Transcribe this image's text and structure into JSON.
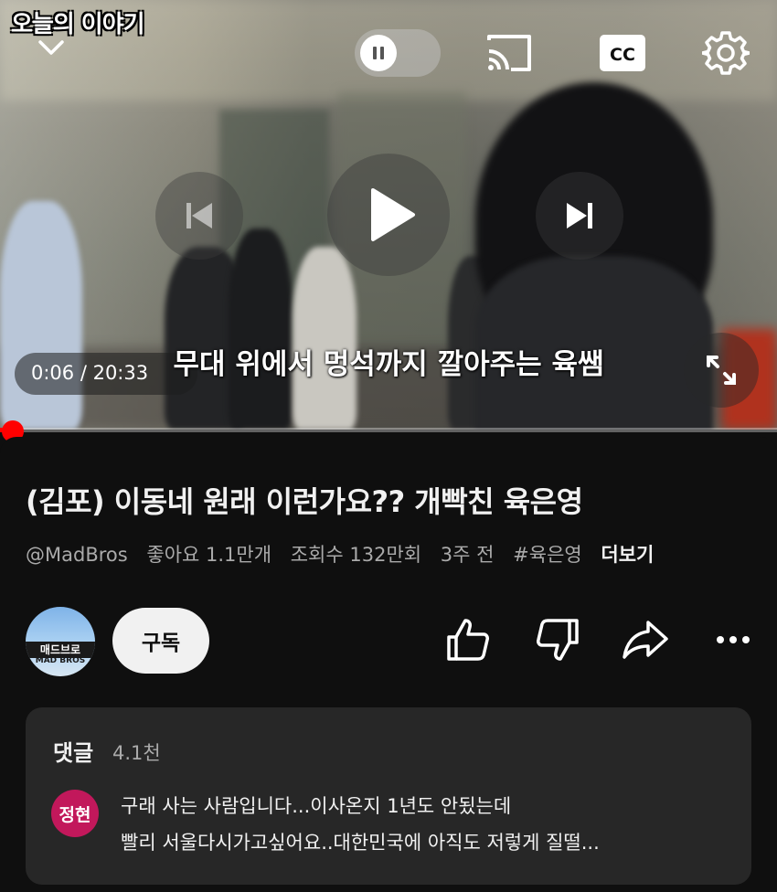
{
  "video": {
    "watermark": "오늘의 이야기",
    "subtitle": "무대 위에서 멍석까지 깔아주는 육쌤",
    "time": "0:06 / 20:33",
    "progress": 0.0049
  },
  "icons": {
    "collapse": "chevron-down-icon",
    "autoplay": "pause-toggle-icon",
    "cast": "cast-icon",
    "captions": "cc-icon",
    "settings": "gear-icon",
    "previous": "skip-previous-icon",
    "play": "play-icon",
    "next": "skip-next-icon",
    "fullscreen": "fullscreen-icon",
    "like": "thumbs-up-icon",
    "dislike": "thumbs-down-icon",
    "share": "share-icon",
    "more": "more-horiz-icon"
  },
  "captions_label": "CC",
  "info": {
    "title": "(김포) 이동네 원래 이런가요?? 개빡친 육은영",
    "channel_handle": "@MadBros",
    "likes": "좋아요 1.1만개",
    "views": "조회수 132만회",
    "age": "3주 전",
    "hashtag": "#육은영",
    "more_label": "더보기"
  },
  "channel": {
    "avatar_text": "매드브로",
    "avatar_subtext": "MAD BROS",
    "subscribe_label": "구독"
  },
  "comments": {
    "heading": "댓글",
    "count": "4.1천",
    "top_comment": {
      "author_avatar": "정현",
      "line1": "구래 사는 사람입니다...이사온지 1년도 안됬는데",
      "line2": "빨리 서울다시가고싶어요..대한민국에 아직도 저렇게 질떨..."
    }
  },
  "colors": {
    "accent": "#ff0000",
    "background": "#0f0f0f",
    "comment_card": "#272727",
    "comment_avatar": "#c2185b"
  }
}
